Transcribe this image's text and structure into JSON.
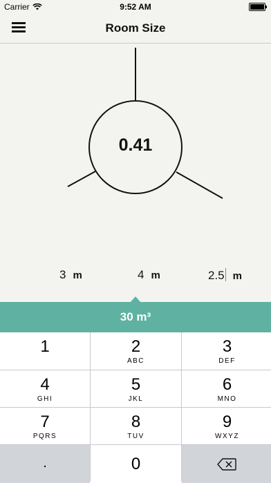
{
  "status_bar": {
    "carrier": "Carrier",
    "time": "9:52 AM",
    "battery_level": 1.0
  },
  "nav": {
    "title": "Room Size",
    "menu_icon": "hamburger-menu-icon"
  },
  "diagram": {
    "ratio": "0.41"
  },
  "dimensions": [
    {
      "value": "3",
      "unit": "m"
    },
    {
      "value": "4",
      "unit": "m"
    },
    {
      "value": "2.5",
      "unit": "m"
    }
  ],
  "result": {
    "volume": "30 m³"
  },
  "keypad": {
    "keys": [
      {
        "digit": "1",
        "letters": ""
      },
      {
        "digit": "2",
        "letters": "ABC"
      },
      {
        "digit": "3",
        "letters": "DEF"
      },
      {
        "digit": "4",
        "letters": "GHI"
      },
      {
        "digit": "5",
        "letters": "JKL"
      },
      {
        "digit": "6",
        "letters": "MNO"
      },
      {
        "digit": "7",
        "letters": "PQRS"
      },
      {
        "digit": "8",
        "letters": "TUV"
      },
      {
        "digit": "9",
        "letters": "WXYZ"
      }
    ],
    "dot": ".",
    "zero": "0",
    "delete_icon": "backspace-icon"
  },
  "colors": {
    "accent": "#5fb2a1",
    "background": "#f3f3ef",
    "keypad_bg": "#c6c8cc"
  }
}
